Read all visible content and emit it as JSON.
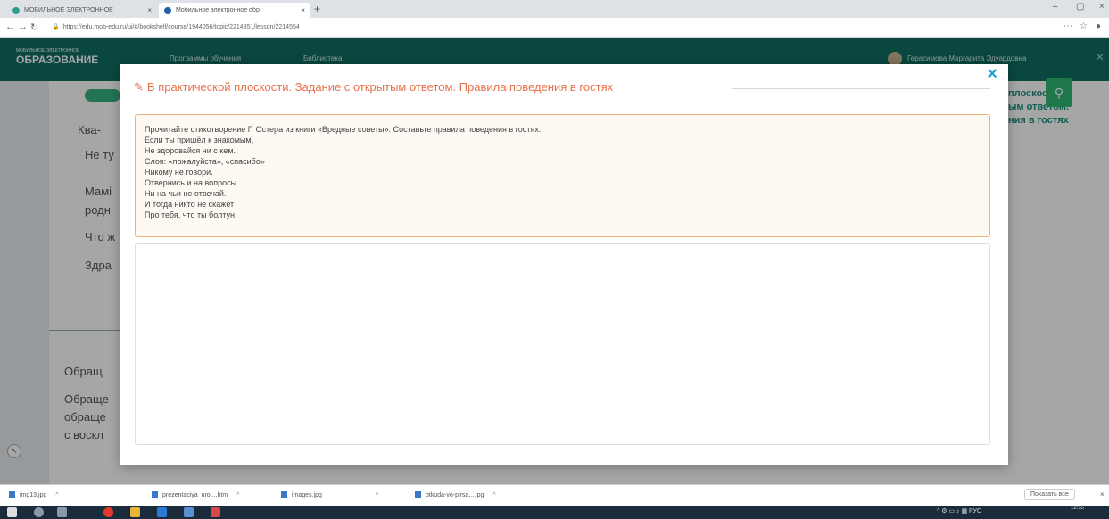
{
  "browser": {
    "tabs": [
      {
        "title": "МОБИЛЬНОЕ ЭЛЕКТРОННОЕ",
        "close": "×"
      },
      {
        "title": "Мобильное электронное обр",
        "close": "×"
      }
    ],
    "new_tab": "+",
    "url": "https://edu.mob-edu.ru/ui/#/bookshelf/course/1944056/topic/2214351/lesson/2214554",
    "window_controls": [
      "–",
      "▢",
      "×"
    ]
  },
  "site": {
    "logo_small": "МОБИЛЬНОЕ ЭЛЕКТРОННОЕ",
    "logo": "ОБРАЗОВАНИЕ",
    "nav": [
      "Программы обучения",
      "Библиотека"
    ],
    "user": "Герасимова Маргарита Эдуардовна",
    "header_close": "×"
  },
  "background": {
    "lines": [
      "Ква-",
      "Не ту",
      "Мамі",
      "родн",
      "Что ж",
      "Здра",
      "Обращ",
      "Обраще",
      "обраще",
      "с воскл"
    ],
    "side_panel": [
      "плоскости.",
      "ым ответом.",
      "ния в гостях"
    ]
  },
  "modal": {
    "close": "×",
    "title": "В практической плоскости. Задание с открытым ответом. Правила поведения в гостях",
    "task_lines": [
      "Прочитайте стихотворение Г. Остера из книги «Вредные советы». Составьте правила поведения в гостях.",
      "Если ты пришёл к знакомым,",
      "Не здоровайся ни с кем.",
      "Слов: «пожалуйста», «спасибо»",
      "Никому не говори.",
      "Отвернись и на вопросы",
      "Ни на чьи не отвечай.",
      "И тогда никто не скажет",
      "Про тебя, что ты болтун."
    ],
    "answer_value": ""
  },
  "downloads": {
    "items": [
      "img13.jpg",
      "prezentaciya_uro....htm",
      "images.jpg",
      "otkuda-vo-pirsa....jpg"
    ],
    "show_all": "Показать все",
    "close": "×"
  },
  "taskbar": {
    "clock_time": "12:55",
    "lang": "РУС"
  }
}
